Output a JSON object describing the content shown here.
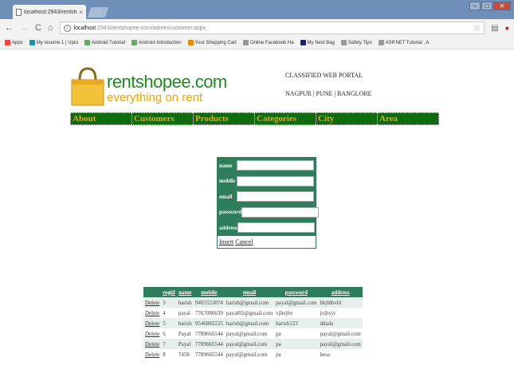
{
  "browser": {
    "tab_title": "localhost:2943/rentshop",
    "tab_close": "×",
    "url_host": "localhost",
    "url_path": ":2943/rentshopee.com/admin/customer.aspx",
    "bookmarks": [
      {
        "label": "Apps",
        "icon_color": "#e44"
      },
      {
        "label": "My resume 1 | Upto",
        "icon_color": "#19a"
      },
      {
        "label": "Android Tutorial",
        "icon_color": "#6a6"
      },
      {
        "label": "Android Introduction",
        "icon_color": "#6a6"
      },
      {
        "label": "Your Shopping Cart",
        "icon_color": "#e80"
      },
      {
        "label": "Online Facebook Ha",
        "icon_color": "#999"
      },
      {
        "label": "My Next Bag",
        "icon_color": "#226"
      },
      {
        "label": "Safety Tips",
        "icon_color": "#999"
      },
      {
        "label": "ASP.NET Tutorial , A",
        "icon_color": "#999"
      }
    ]
  },
  "site": {
    "logo_name": "rentshopee.com",
    "logo_tagline": "everything on rent",
    "portal_title": "CLASSIFIED WEB PORTAL",
    "cities": "NAGPUR | PUNE | BANGLORE",
    "nav": [
      "About",
      "Customers",
      "Products",
      "Categories",
      "City",
      "Area"
    ]
  },
  "form": {
    "fields": [
      "name",
      "mobile",
      "email",
      "password",
      "address"
    ],
    "insert_label": "Insert",
    "cancel_label": "Cancel"
  },
  "grid": {
    "delete_label": "Delete",
    "headers": [
      "regid",
      "name",
      "mobile",
      "email",
      "password",
      "address"
    ],
    "rows": [
      [
        "3",
        "harish",
        "9405553874",
        "harish@gmail.com",
        "payal@gmail.com",
        "bkjblhvhl"
      ],
      [
        "4",
        "payal",
        "7767086639",
        "payal02@gmail.com",
        "vjhvjhv",
        "jvjhvjv"
      ],
      [
        "5",
        "harish",
        "9546882225",
        "harish@gmail.com",
        "harish123",
        "ddada"
      ],
      [
        "6",
        "Payal",
        "7789665544",
        "payal@gmail.com",
        "pa",
        "payal@gmail.com"
      ],
      [
        "7",
        "Payal",
        "7789665544",
        "payal@gmail.com",
        "pa",
        "payal@gmail.com"
      ],
      [
        "8",
        "7458",
        "7789665544",
        "payal@gmail.com",
        "pa",
        "besa"
      ]
    ]
  }
}
